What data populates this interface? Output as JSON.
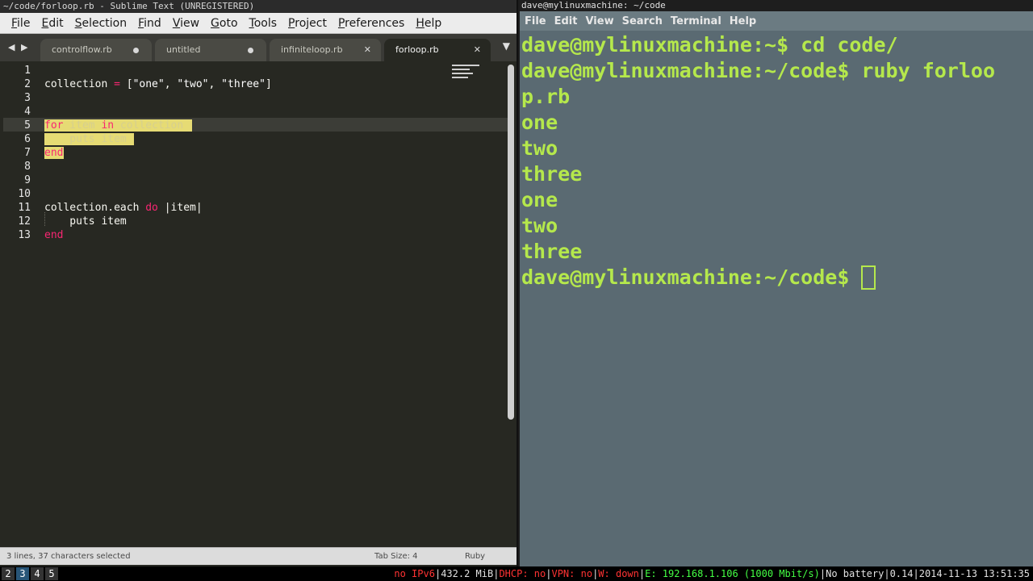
{
  "sublime": {
    "title": "~/code/forloop.rb - Sublime Text (UNREGISTERED)",
    "menu": [
      "File",
      "Edit",
      "Selection",
      "Find",
      "View",
      "Goto",
      "Tools",
      "Project",
      "Preferences",
      "Help"
    ],
    "tabs": [
      {
        "label": "controlflow.rb",
        "state": "modified"
      },
      {
        "label": "untitled",
        "state": "modified"
      },
      {
        "label": "infiniteloop.rb",
        "state": "close"
      },
      {
        "label": "forloop.rb",
        "state": "active"
      }
    ],
    "line_numbers": [
      "1",
      "2",
      "3",
      "4",
      "5",
      "6",
      "7",
      "8",
      "9",
      "10",
      "11",
      "12",
      "13"
    ],
    "code": {
      "l2_a": "collection ",
      "l2_op": "=",
      "l2_b": " [",
      "l2_s1": "\"one\"",
      "l2_c1": ", ",
      "l2_s2": "\"two\"",
      "l2_c2": ", ",
      "l2_s3": "\"three\"",
      "l2_end": "]",
      "l5_for": "for",
      "l5_item": " item ",
      "l5_in": "in",
      "l5_coll": " collection",
      "l6": "    puts item",
      "l7_end": "end",
      "l11_a": "collection.each ",
      "l11_do": "do",
      "l11_b": " |item|",
      "l12": "    puts item",
      "l13_end": "end"
    },
    "status": {
      "left": "3 lines, 37 characters selected",
      "tab_size": "Tab Size: 4",
      "syntax": "Ruby"
    }
  },
  "terminal": {
    "title": "dave@mylinuxmachine: ~/code",
    "menu": [
      "File",
      "Edit",
      "View",
      "Search",
      "Terminal",
      "Help"
    ],
    "lines": [
      "dave@mylinuxmachine:~$ cd code/",
      "dave@mylinuxmachine:~/code$ ruby forloo",
      "p.rb",
      "one",
      "two",
      "three",
      "one",
      "two",
      "three"
    ],
    "prompt": "dave@mylinuxmachine:~/code$ "
  },
  "bottombar": {
    "workspaces": [
      "2",
      "3",
      "4",
      "5"
    ],
    "active_workspace": "3",
    "ipv6": "no IPv6",
    "disk": "432.2 MiB",
    "dhcp": "DHCP: no",
    "vpn": "VPN: no",
    "wifi": "W: down",
    "eth": "E: 192.168.1.106 (1000 Mbit/s)",
    "battery": "No battery",
    "load": "0.14",
    "datetime": "2014-11-13 13:51:35",
    "separator": "|"
  },
  "colors": {
    "terminal_text": "#b5e84c",
    "terminal_bg": "#5a6a72",
    "editor_bg": "#272822",
    "keyword": "#f92672",
    "selection": "#e6db74"
  }
}
